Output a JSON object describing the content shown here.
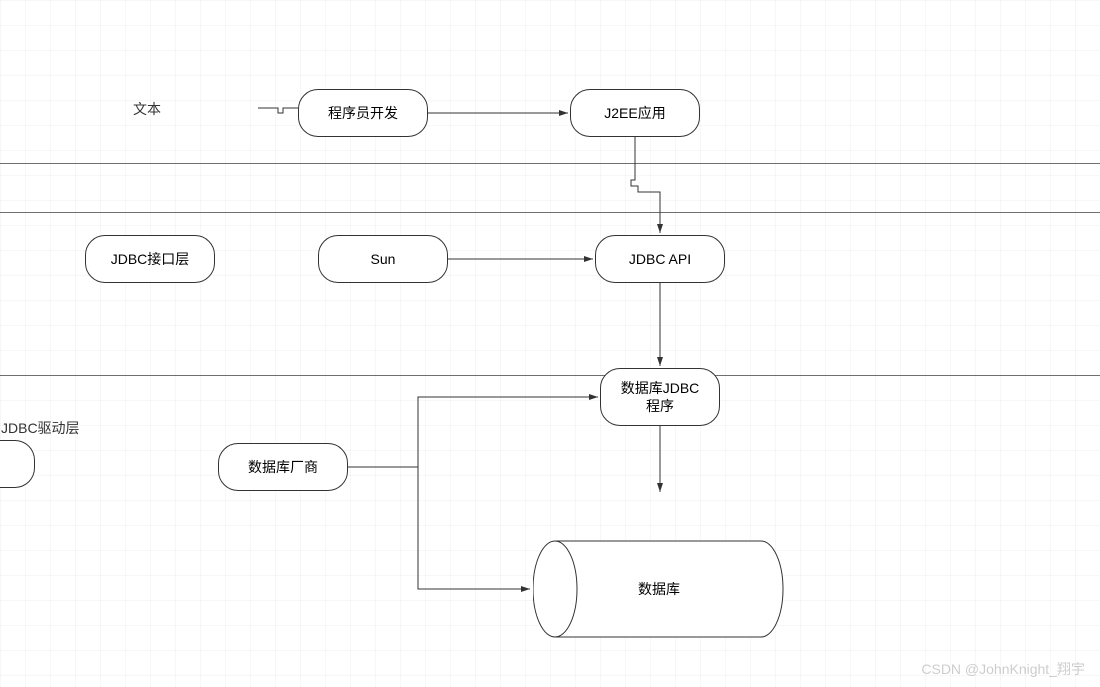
{
  "labels": {
    "text_label": "文本",
    "jdbc_interface_layer": "JDBC接口层",
    "jdbc_driver_layer": "JDBC驱动层"
  },
  "nodes": {
    "programmer_dev": "程序员开发",
    "j2ee_app": "J2EE应用",
    "sun": "Sun",
    "jdbc_api": "JDBC API",
    "db_jdbc_program": "数据库JDBC\n程序",
    "db_vendor": "数据库厂商",
    "database": "数据库"
  },
  "watermark": "CSDN @JohnKnight_翔宇"
}
